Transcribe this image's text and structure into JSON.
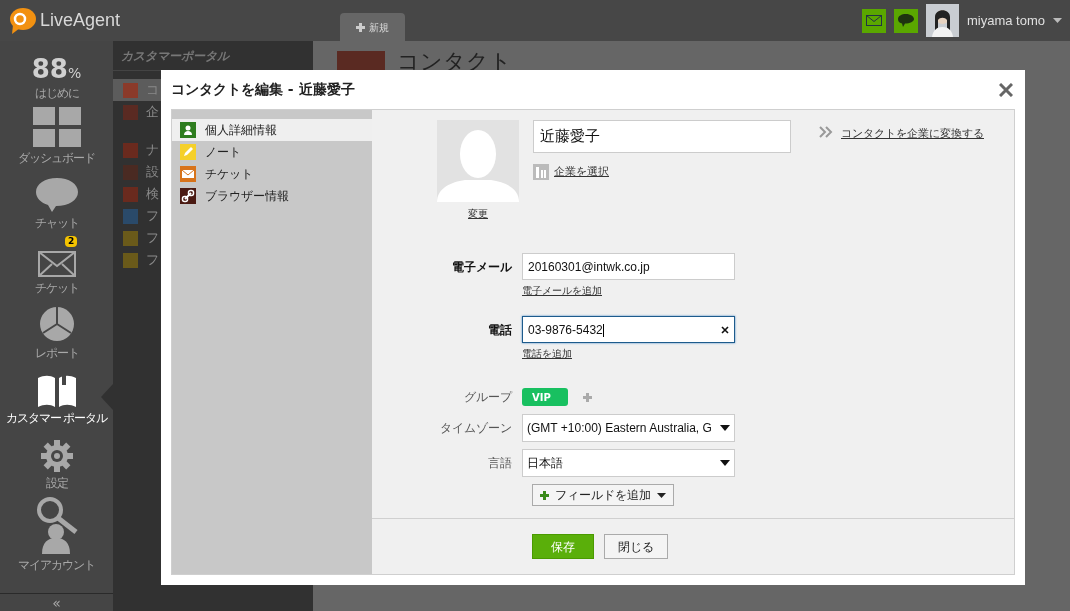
{
  "app": {
    "logo": "LiveAgent",
    "new_tab": "新規",
    "user_name": "miyama tomo"
  },
  "nav": [
    {
      "kind": "score",
      "value": "88",
      "unit": "%",
      "label": "はじめに",
      "selected": false
    },
    {
      "kind": "dashboard",
      "label": "ダッシュボード",
      "selected": false
    },
    {
      "kind": "chat",
      "label": "チャット",
      "selected": false
    },
    {
      "kind": "ticket",
      "label": "チケット",
      "badge": "2",
      "selected": false
    },
    {
      "kind": "report",
      "label": "レポート",
      "selected": false
    },
    {
      "kind": "portal",
      "label": "カスタマー ポータル",
      "selected": true
    },
    {
      "kind": "settings",
      "label": "設定",
      "selected": false
    },
    {
      "kind": "account",
      "label": "マイアカウント",
      "selected": false
    }
  ],
  "nav_collapse": "«",
  "portal_panel": {
    "title": "カスタマーポータル",
    "items": [
      {
        "text": "コ",
        "color": "#8a3a2a",
        "selected": true
      },
      {
        "text": "企",
        "color": "#5a2a22",
        "selected": false
      },
      {
        "text": "ナ",
        "color": "#6a2a1e",
        "selected": false
      },
      {
        "text": "設",
        "color": "#4a2a22",
        "selected": false
      },
      {
        "text": "検",
        "color": "#6a2a1e",
        "selected": false
      },
      {
        "text": "フ",
        "color": "#2a4a6a",
        "selected": false
      },
      {
        "text": "フ",
        "color": "#6a5a1a",
        "selected": false
      },
      {
        "text": "フ",
        "color": "#6a5a1a",
        "selected": false
      }
    ]
  },
  "main": {
    "title": "コンタクト"
  },
  "dialog": {
    "title": "コンタクトを編集 - 近藤愛子",
    "sections": [
      {
        "kind": "person",
        "label": "個人詳細情報",
        "selected": true
      },
      {
        "kind": "note",
        "label": "ノート",
        "selected": false
      },
      {
        "kind": "ticket",
        "label": "チケット",
        "selected": false
      },
      {
        "kind": "browser",
        "label": "ブラウザー情報",
        "selected": false
      }
    ],
    "change_photo": "変更",
    "name": "近藤愛子",
    "select_company": "企業を選択",
    "convert_link": "コンタクトを企業に変換する",
    "fields": [
      {
        "kind": "text",
        "label": "電子メール",
        "value": "20160301@intwk.co.jp",
        "add_link": "電子メールを追加",
        "focused": false
      },
      {
        "kind": "text",
        "label": "電話",
        "value": "03-9876-5432",
        "add_link": "電話を追加",
        "focused": true
      },
      {
        "kind": "groups",
        "label": "グループ",
        "tags": [
          "VIP"
        ]
      },
      {
        "kind": "select",
        "label": "タイムゾーン",
        "value": "(GMT +10:00) Eastern Australia, G"
      },
      {
        "kind": "select",
        "label": "言語",
        "value": "日本語"
      }
    ],
    "add_field": "フィールドを追加",
    "save": "保存",
    "close": "閉じる"
  }
}
